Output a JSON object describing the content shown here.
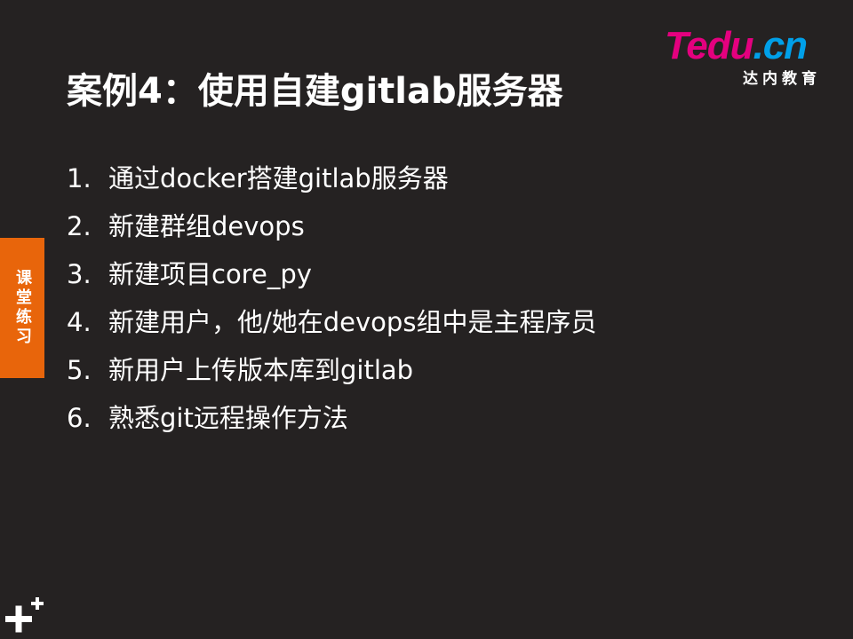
{
  "slide": {
    "title": "案例4：使用自建gitlab服务器"
  },
  "logo": {
    "brand_t": "T",
    "brand_rest": "edu",
    "brand_cn": ".cn",
    "subtitle": "达内教育"
  },
  "side_tab": {
    "label": "课堂练习"
  },
  "items": [
    {
      "num": "1.",
      "text": "通过docker搭建gitlab服务器"
    },
    {
      "num": "2.",
      "text": "新建群组devops"
    },
    {
      "num": "3.",
      "text": "新建项目core_py"
    },
    {
      "num": "4.",
      "text": "新建用户，他/她在devops组中是主程序员"
    },
    {
      "num": "5.",
      "text": "新用户上传版本库到gitlab"
    },
    {
      "num": "6.",
      "text": "熟悉git远程操作方法"
    }
  ],
  "colors": {
    "background": "#252222",
    "accent_orange": "#e8650b",
    "logo_magenta": "#e4007f",
    "logo_blue": "#00a0e9"
  },
  "icons": {
    "corner": "plus-icon"
  }
}
